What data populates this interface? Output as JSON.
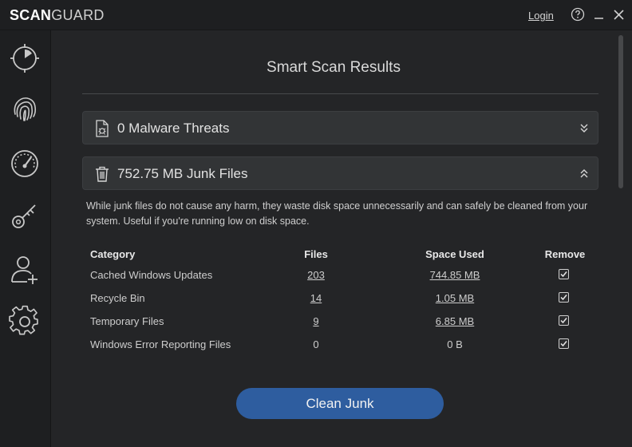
{
  "app": {
    "logo_bold": "SCAN",
    "logo_light": "GUARD",
    "login_label": "Login"
  },
  "titlebar_icons": [
    "help-icon",
    "minimize-icon",
    "close-icon"
  ],
  "sidebar": {
    "items": [
      {
        "name": "scan",
        "icon": "scan-dial-icon"
      },
      {
        "name": "fingerprint",
        "icon": "fingerprint-icon"
      },
      {
        "name": "speedometer",
        "icon": "speedometer-icon"
      },
      {
        "name": "password-manager",
        "icon": "key-icon"
      },
      {
        "name": "add-user",
        "icon": "add-user-icon"
      },
      {
        "name": "settings",
        "icon": "gear-icon"
      }
    ]
  },
  "main": {
    "title": "Smart Scan Results",
    "panels": [
      {
        "label": "0 Malware Threats",
        "icon": "malware-file-icon",
        "state": "collapsed"
      },
      {
        "label": "752.75 MB Junk Files",
        "icon": "trash-icon",
        "state": "expanded"
      }
    ],
    "description": "While junk files do not cause any harm, they waste disk space unnecessarily and can safely be cleaned from your system. Useful if you're running low on disk space.",
    "table": {
      "headers": {
        "category": "Category",
        "files": "Files",
        "space": "Space Used",
        "remove": "Remove"
      },
      "rows": [
        {
          "category": "Cached Windows Updates",
          "files": "203",
          "space": "744.85 MB",
          "remove": true
        },
        {
          "category": "Recycle Bin",
          "files": "14",
          "space": "1.05 MB",
          "remove": true
        },
        {
          "category": "Temporary Files",
          "files": "9",
          "space": "6.85 MB",
          "remove": true
        },
        {
          "category": "Windows Error Reporting Files",
          "files": "0",
          "space": "0 B",
          "remove": true
        }
      ]
    },
    "action_label": "Clean Junk"
  },
  "colors": {
    "background": "#242527",
    "panel": "#323436",
    "button": "#2e5d9f"
  }
}
